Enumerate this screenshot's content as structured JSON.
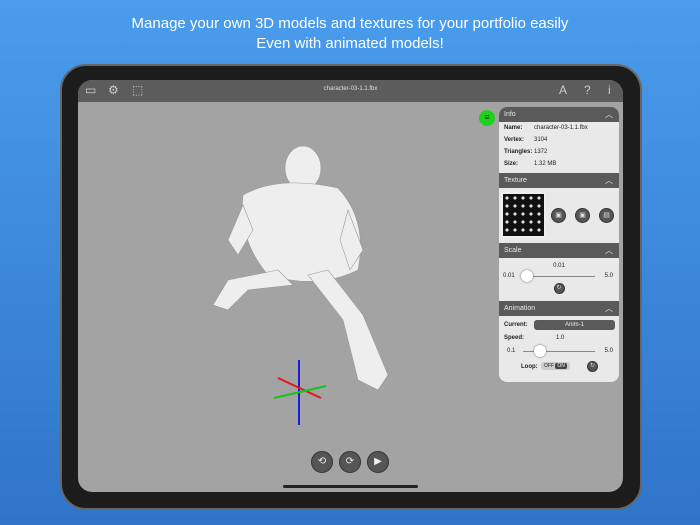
{
  "headline": {
    "line1": "Manage your own 3D models and textures for your portfolio easily",
    "line2": "Even with animated models!"
  },
  "toolbar": {
    "title": "character-03-1.1.fbx",
    "icons": [
      "folder-icon",
      "gear-icon",
      "focus-icon",
      "text-a-icon",
      "help-icon",
      "info-icon"
    ],
    "help": "?",
    "info": "i",
    "a": "A"
  },
  "info": {
    "header": "Info",
    "name_label": "Name:",
    "name": "character-03-1.1.fbx",
    "vertex_label": "Vertex:",
    "vertex": "3104",
    "triangles_label": "Triangles:",
    "triangles": "1372",
    "size_label": "Size:",
    "size": "1.32 MB"
  },
  "texture": {
    "header": "Texture"
  },
  "scale": {
    "header": "Scale",
    "value": "0.01",
    "min": "0.01",
    "max": "5.0",
    "fraction": 0.0
  },
  "animation": {
    "header": "Animation",
    "current_label": "Current:",
    "current": "Anim-1",
    "speed_label": "Speed:",
    "speed": "1.0",
    "min": "0.1",
    "max": "5.0",
    "fraction": 0.18,
    "loop_label": "Loop:",
    "off": "OFF",
    "on": "ON"
  },
  "colors": {
    "accent": "#1ed11e",
    "toolbar": "#5c5c5c"
  }
}
